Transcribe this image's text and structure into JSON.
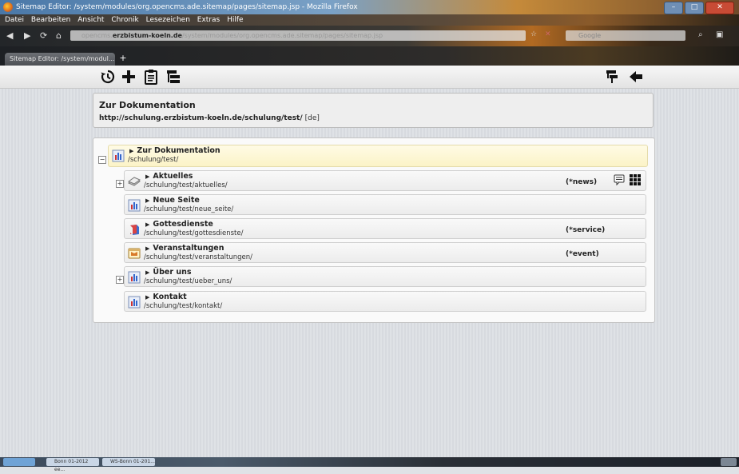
{
  "browser": {
    "window_title": "Sitemap Editor: /system/modules/org.opencms.ade.sitemap/pages/sitemap.jsp - Mozilla Firefox",
    "menu": [
      "Datei",
      "Bearbeiten",
      "Ansicht",
      "Chronik",
      "Lesezeichen",
      "Extras",
      "Hilfe"
    ],
    "url_prefix": "opencms.",
    "url_host": "erzbistum-koeln.de",
    "url_path": "/system/modules/org.opencms.ade.sitemap/pages/sitemap.jsp",
    "search_placeholder": "Google",
    "tab_label": "Sitemap Editor: /system/modul..."
  },
  "toolbar": {
    "icons": [
      "history-icon",
      "add-icon",
      "clipboard-icon",
      "sitemap-icon",
      "filter-icon",
      "back-arrow-icon"
    ]
  },
  "header": {
    "title": "Zur Dokumentation",
    "url": "http://schulung.erzbistum-koeln.de/schulung/test/",
    "lang": "[de]"
  },
  "tree": {
    "root": {
      "title": "Zur Dokumentation",
      "path": "/schulung/test/"
    },
    "children": [
      {
        "title": "Aktuelles",
        "path": "/schulung/test/aktuelles/",
        "badge": "(*news)",
        "icon": "news-icon"
      },
      {
        "title": "Neue Seite",
        "path": "/schulung/test/neue_seite/",
        "badge": "",
        "icon": "page-icon"
      },
      {
        "title": "Gottesdienste",
        "path": "/schulung/test/gottesdienste/",
        "badge": "(*service)",
        "icon": "service-icon"
      },
      {
        "title": "Veranstaltungen",
        "path": "/schulung/test/veranstaltungen/",
        "badge": "(*event)",
        "icon": "event-icon"
      },
      {
        "title": "Über uns",
        "path": "/schulung/test/ueber_uns/",
        "badge": "",
        "icon": "page-icon"
      },
      {
        "title": "Kontakt",
        "path": "/schulung/test/kontakt/",
        "badge": "",
        "icon": "page-icon"
      }
    ]
  },
  "taskbar": {
    "items": [
      "Bonn 01-2012 ee...",
      "WS-Bonn 01-201..."
    ]
  }
}
